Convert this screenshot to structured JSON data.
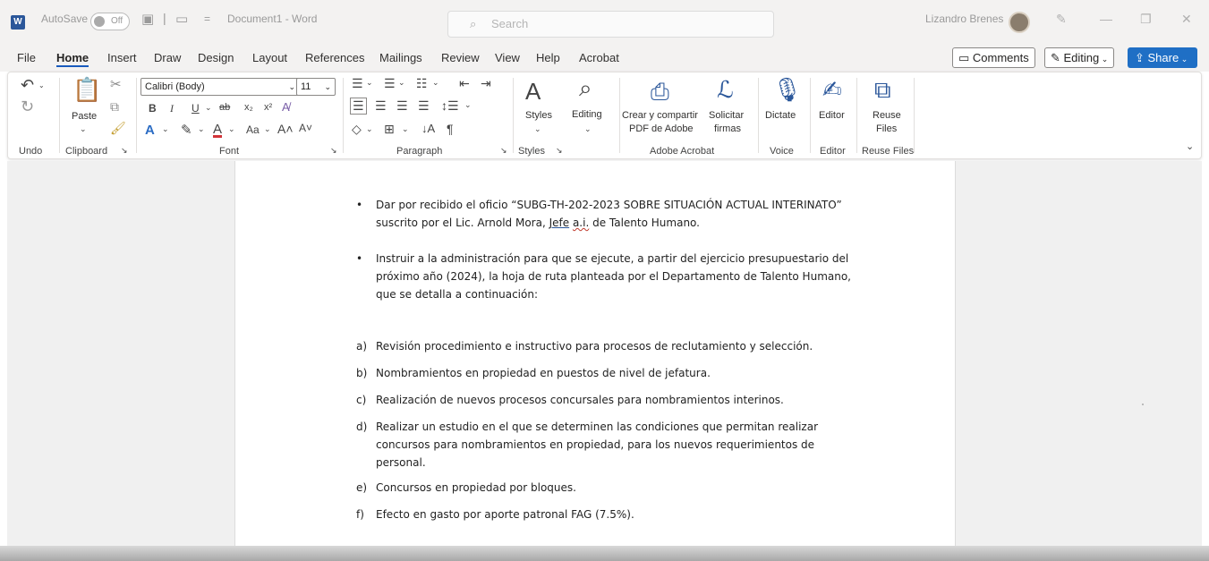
{
  "titlebar": {
    "autosave_label": "AutoSave",
    "autosave_state": "Off",
    "doc_title": "Document1 - Word",
    "search_placeholder": "Search",
    "user_name": "Lizandro Brenes"
  },
  "menu": {
    "tabs": [
      "File",
      "Home",
      "Insert",
      "Draw",
      "Design",
      "Layout",
      "References",
      "Mailings",
      "Review",
      "View",
      "Help",
      "Acrobat"
    ],
    "comments": "Comments",
    "editing": "Editing",
    "share": "Share"
  },
  "ribbon": {
    "groups": {
      "undo": "Undo",
      "clipboard": "Clipboard",
      "font": "Font",
      "paragraph": "Paragraph",
      "styles": "Styles",
      "adobe": "Adobe Acrobat",
      "voice": "Voice",
      "editor": "Editor",
      "reuse": "Reuse Files"
    },
    "paste": "Paste",
    "font_name": "Calibri (Body)",
    "font_size": "11",
    "styles": "Styles",
    "editing": "Editing",
    "crear_1": "Crear y compartir",
    "crear_2": "PDF de Adobe",
    "solicitar_1": "Solicitar",
    "solicitar_2": "firmas",
    "dictate": "Dictate",
    "editor": "Editor",
    "reuse_1": "Reuse",
    "reuse_2": "Files"
  },
  "document": {
    "bullets": [
      {
        "line1": "Dar por recibido el oficio “SUBG-TH-202-2023 SOBRE SITUACIÓN ACTUAL INTERINATO”",
        "line2_pre": "suscrito por el Lic. Arnold Mora, ",
        "line2_jefe": "Jefe",
        "line2_ai": "a.i.",
        "line2_post": " de Talento Humano."
      },
      {
        "text": "Instruir a la administración para que se ejecute, a partir del ejercicio presupuestario del próximo año (2024), la hoja de ruta planteada por el Departamento de Talento Humano, que se detalla a continuación:"
      }
    ],
    "items": [
      {
        "marker": "a)",
        "text": "Revisión procedimiento e instructivo para procesos de reclutamiento y selección."
      },
      {
        "marker": "b)",
        "text": "Nombramientos en propiedad en puestos de nivel de jefatura."
      },
      {
        "marker": "c)",
        "text": "Realización de nuevos procesos concursales para nombramientos interinos."
      },
      {
        "marker": "d)",
        "text": "Realizar un estudio en el que se determinen las condiciones que permitan realizar concursos para nombramientos en  propiedad, para los nuevos requerimientos de personal."
      },
      {
        "marker": "e)",
        "text": "Concursos en propiedad por bloques."
      },
      {
        "marker": "f)",
        "text": "Efecto en gasto por aporte patronal FAG (7.5%)."
      }
    ]
  }
}
